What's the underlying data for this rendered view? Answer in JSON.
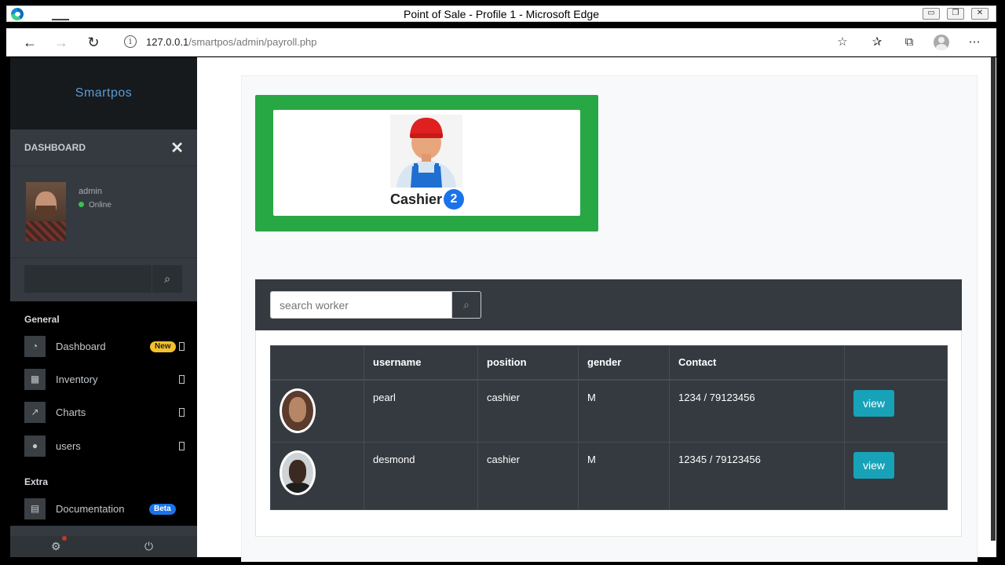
{
  "browser": {
    "window_title": "Point of Sale - Profile 1 - Microsoft Edge",
    "url_host": "127.0.0.1",
    "url_path": "/smartpos/admin/payroll.php"
  },
  "sidebar": {
    "brand": "Smartpos",
    "dashboard_label": "DASHBOARD",
    "user": {
      "name": "admin",
      "status": "Online"
    },
    "sections": [
      {
        "title": "General",
        "items": [
          {
            "label": "Dashboard",
            "badge": "New"
          },
          {
            "label": "Inventory"
          },
          {
            "label": "Charts"
          },
          {
            "label": "users"
          }
        ]
      },
      {
        "title": "Extra",
        "items": [
          {
            "label": "Documentation",
            "badge": "Beta"
          }
        ]
      }
    ]
  },
  "category_card": {
    "label": "Cashier",
    "count": "2"
  },
  "workers": {
    "search_placeholder": "search worker",
    "columns": [
      "",
      "username",
      "position",
      "gender",
      "Contact",
      ""
    ],
    "rows": [
      {
        "username": "pearl",
        "position": "cashier",
        "gender": "M",
        "contact": "1234 / 79123456",
        "action": "view"
      },
      {
        "username": "desmond",
        "position": "cashier",
        "gender": "M",
        "contact": "12345 / 79123456",
        "action": "view"
      }
    ]
  },
  "colors": {
    "card_green": "#28a745",
    "view_button": "#17a2b8",
    "count_badge": "#1a73e8",
    "new_badge": "#f3c12b",
    "dark": "#343a40"
  }
}
